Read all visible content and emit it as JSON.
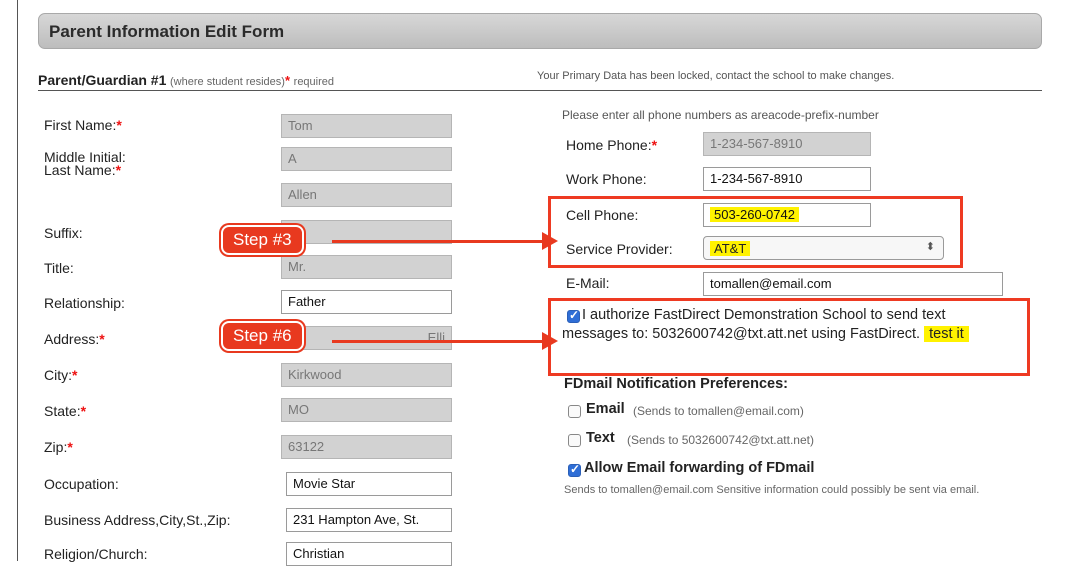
{
  "form_title": "Parent Information Edit Form",
  "section": {
    "heading": "Parent/Guardian #1",
    "subheading": "(where student resides)",
    "required_star": "*",
    "required_label": "required"
  },
  "locked_note": "Your Primary Data has been locked, contact the school to make changes.",
  "phone_note": "Please enter all phone numbers as areacode-prefix-number",
  "left_fields": [
    {
      "label": "First Name:",
      "required": "*",
      "value": "Tom"
    },
    {
      "label": "Middle Initial:",
      "required": "",
      "value": "A"
    },
    {
      "label": "Last Name:",
      "required": "*",
      "value": "Allen"
    },
    {
      "label": "Suffix:",
      "required": "",
      "value": ""
    },
    {
      "label": "Title:",
      "required": "",
      "value": "Mr."
    },
    {
      "label": "Relationship:",
      "required": "",
      "value": "Father"
    },
    {
      "label": "Address:",
      "required": "*",
      "value": "Elli"
    },
    {
      "label": "City:",
      "required": "*",
      "value": "Kirkwood"
    },
    {
      "label": "State:",
      "required": "*",
      "value": "MO"
    },
    {
      "label": "Zip:",
      "required": "*",
      "value": "63122"
    },
    {
      "label": "Occupation:",
      "required": "",
      "value": "Movie Star"
    },
    {
      "label": "Business Address,City,St.,Zip:",
      "required": "",
      "value": "231 Hampton Ave, St."
    },
    {
      "label": "Religion/Church:",
      "required": "",
      "value": "Christian"
    }
  ],
  "right_fields": {
    "home_phone": {
      "label": "Home Phone:",
      "required": "*",
      "value": "1-234-567-8910"
    },
    "work_phone": {
      "label": "Work Phone:",
      "value": "1-234-567-8910"
    },
    "cell_phone": {
      "label": "Cell Phone:",
      "value": "503-260-0742"
    },
    "service_provider": {
      "label": "Service Provider:",
      "value": "AT&T",
      "arrows": "⬍"
    },
    "email": {
      "label": "E-Mail:",
      "value": "tomallen@email.com"
    }
  },
  "authorize": {
    "checked": true,
    "text": "I authorize FastDirect Demonstration School to send text messages to: 5032600742@txt.att.net using FastDirect.",
    "test_link": "test it"
  },
  "fdmail": {
    "heading": "FDmail Notification Preferences:",
    "email_label": "Email",
    "email_note": "(Sends to tomallen@email.com)",
    "text_label": "Text",
    "text_note": "(Sends to 5032600742@txt.att.net)",
    "forward_label": "Allow Email forwarding of FDmail",
    "forward_note": "Sends to tomallen@email.com Sensitive information could possibly be sent via email."
  },
  "callouts": {
    "step3": "Step #3",
    "step6": "Step #6"
  },
  "colors": {
    "callout": "#e8391f",
    "highlight": "#fff200",
    "required": "#e11111",
    "locked_field": "#d2d2d2"
  }
}
